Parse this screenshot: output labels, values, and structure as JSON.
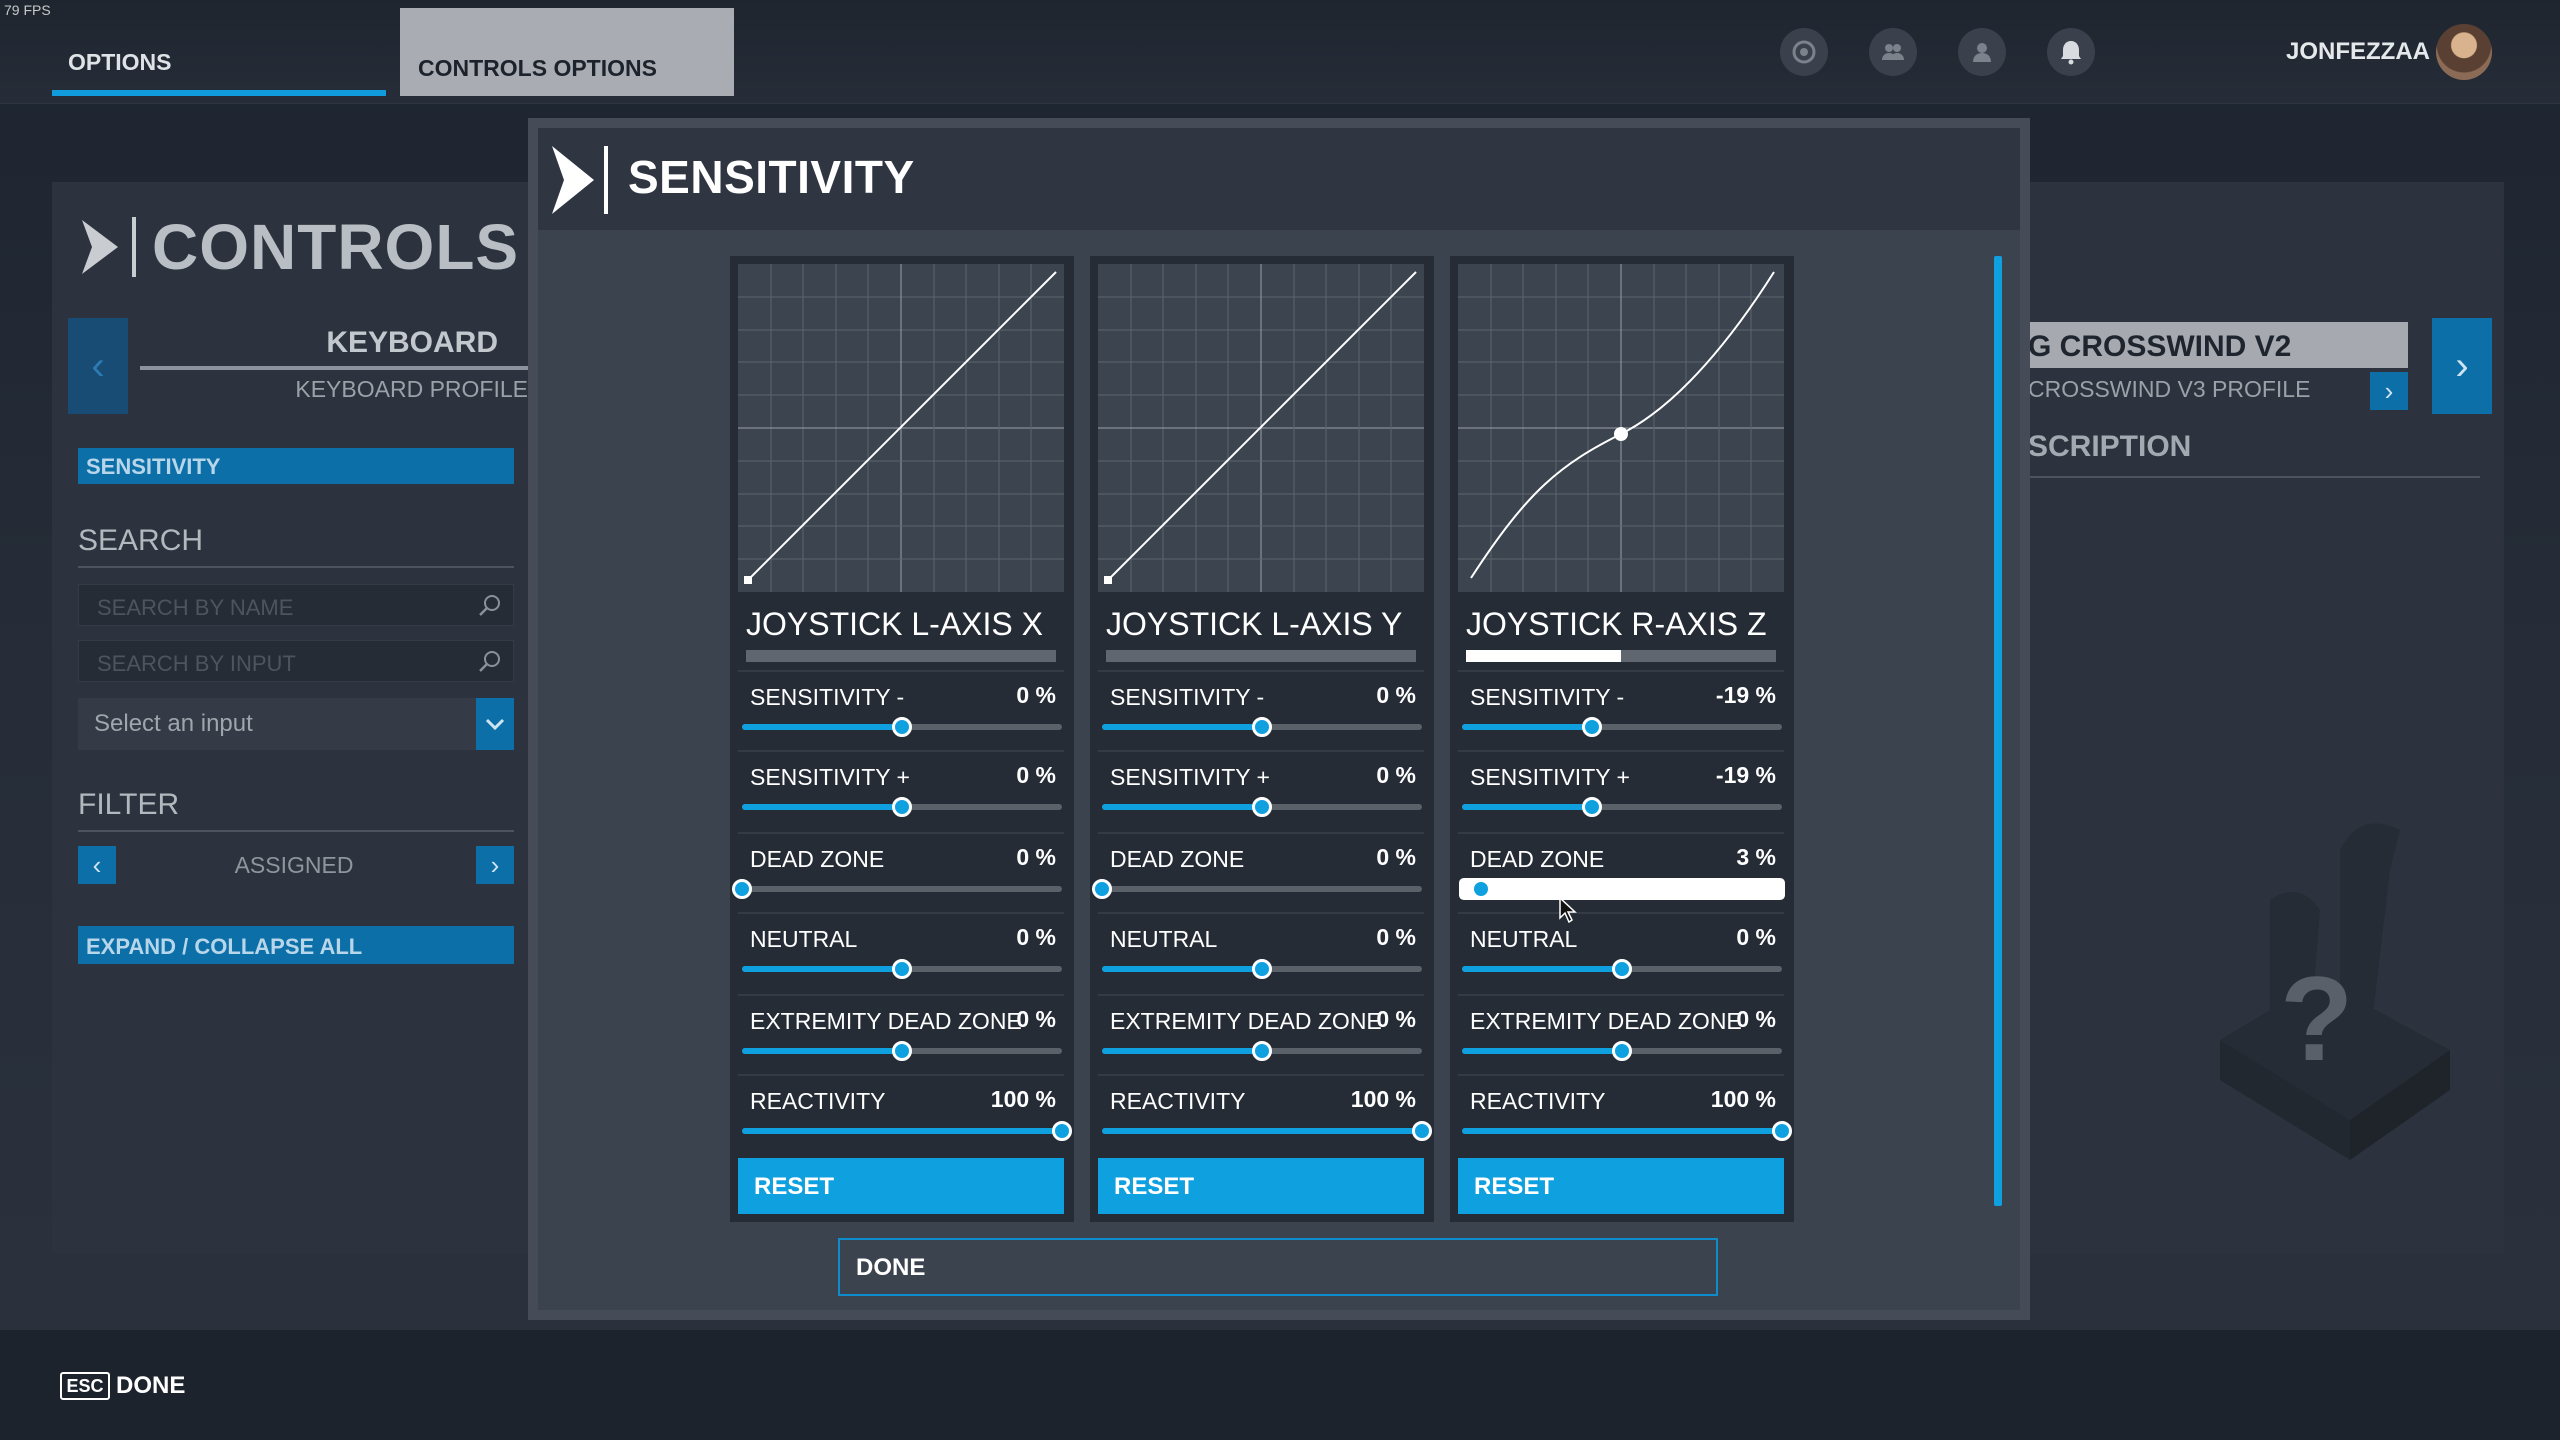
{
  "fps": "79 FPS",
  "topbar": {
    "tabs": [
      {
        "label": "OPTIONS"
      },
      {
        "label": "CONTROLS OPTIONS"
      }
    ],
    "icons": [
      "target-icon",
      "friends-icon",
      "profile-icon",
      "bell-icon"
    ],
    "username": "JONFEZZAA"
  },
  "left_panel": {
    "title": "CONTROLS C",
    "device": "KEYBOARD",
    "profile": "KEYBOARD PROFILE",
    "sensitivity_button": "SENSITIVITY",
    "search_label": "SEARCH",
    "search_by_name_placeholder": "SEARCH BY NAME",
    "search_by_input_placeholder": "SEARCH BY INPUT",
    "select_input": "Select an input",
    "filter_label": "FILTER",
    "filter_value": "ASSIGNED",
    "expand_collapse": "EXPAND / COLLAPSE ALL"
  },
  "right_panel": {
    "device": "G CROSSWIND V2",
    "profile": "CROSSWIND V3 PROFILE",
    "description_label": "SCRIPTION",
    "unknown_glyph": "?"
  },
  "modal": {
    "title": "SENSITIVITY",
    "done": "DONE",
    "columns": [
      {
        "axis": "JOYSTICK L-AXIS X",
        "input_level": 0,
        "curve": "linear",
        "rows": [
          {
            "label": "SENSITIVITY -",
            "value": "0 %",
            "pos": 0.5
          },
          {
            "label": "SENSITIVITY +",
            "value": "0 %",
            "pos": 0.5
          },
          {
            "label": "DEAD ZONE",
            "value": "0 %",
            "pos": 0.0
          },
          {
            "label": "NEUTRAL",
            "value": "0 %",
            "pos": 0.5
          },
          {
            "label": "EXTREMITY DEAD ZONE",
            "value": "0 %",
            "pos": 0.5
          },
          {
            "label": "REACTIVITY",
            "value": "100 %",
            "pos": 1.0
          }
        ],
        "reset": "RESET"
      },
      {
        "axis": "JOYSTICK L-AXIS Y",
        "input_level": 0,
        "curve": "linear",
        "rows": [
          {
            "label": "SENSITIVITY -",
            "value": "0 %",
            "pos": 0.5
          },
          {
            "label": "SENSITIVITY +",
            "value": "0 %",
            "pos": 0.5
          },
          {
            "label": "DEAD ZONE",
            "value": "0 %",
            "pos": 0.0
          },
          {
            "label": "NEUTRAL",
            "value": "0 %",
            "pos": 0.5
          },
          {
            "label": "EXTREMITY DEAD ZONE",
            "value": "0 %",
            "pos": 0.5
          },
          {
            "label": "REACTIVITY",
            "value": "100 %",
            "pos": 1.0
          }
        ],
        "reset": "RESET"
      },
      {
        "axis": "JOYSTICK R-AXIS Z",
        "input_level": 0.5,
        "curve": "s-curve",
        "rows": [
          {
            "label": "SENSITIVITY -",
            "value": "-19 %",
            "pos": 0.405
          },
          {
            "label": "SENSITIVITY +",
            "value": "-19 %",
            "pos": 0.405
          },
          {
            "label": "DEAD ZONE",
            "value": "3 %",
            "pos": 0.06,
            "active": true
          },
          {
            "label": "NEUTRAL",
            "value": "0 %",
            "pos": 0.5
          },
          {
            "label": "EXTREMITY DEAD ZONE",
            "value": "0 %",
            "pos": 0.5
          },
          {
            "label": "REACTIVITY",
            "value": "100 %",
            "pos": 1.0
          }
        ],
        "reset": "RESET"
      }
    ]
  },
  "footer": {
    "key": "ESC",
    "label": "DONE"
  },
  "colors": {
    "accent": "#0fa0e0",
    "accent_dark": "#0d6fa8",
    "panel": "#2c333e",
    "modal": "#3b434f"
  }
}
